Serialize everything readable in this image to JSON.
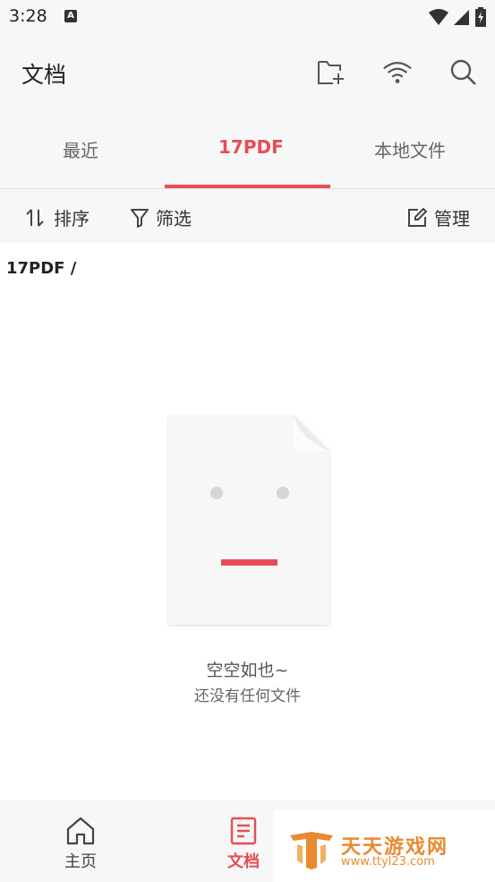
{
  "status_bar": {
    "time": "3:28",
    "notification_letter": "A"
  },
  "header": {
    "title": "文档"
  },
  "tabs": [
    {
      "label": "最近",
      "active": false
    },
    {
      "label": "17PDF",
      "active": true
    },
    {
      "label": "本地文件",
      "active": false
    }
  ],
  "toolbar": {
    "sort_label": "排序",
    "filter_label": "筛选",
    "manage_label": "管理"
  },
  "breadcrumb": "17PDF /",
  "empty_state": {
    "title": "空空如也~",
    "subtitle": "还没有任何文件"
  },
  "bottom_nav": {
    "home_label": "主页",
    "docs_label": "文档"
  },
  "watermark": {
    "name": "天天游戏网",
    "url": "www.ttyl23.com"
  },
  "colors": {
    "accent": "#e84d55",
    "background": "#f7f7f7",
    "watermark": "#e88a2f"
  }
}
